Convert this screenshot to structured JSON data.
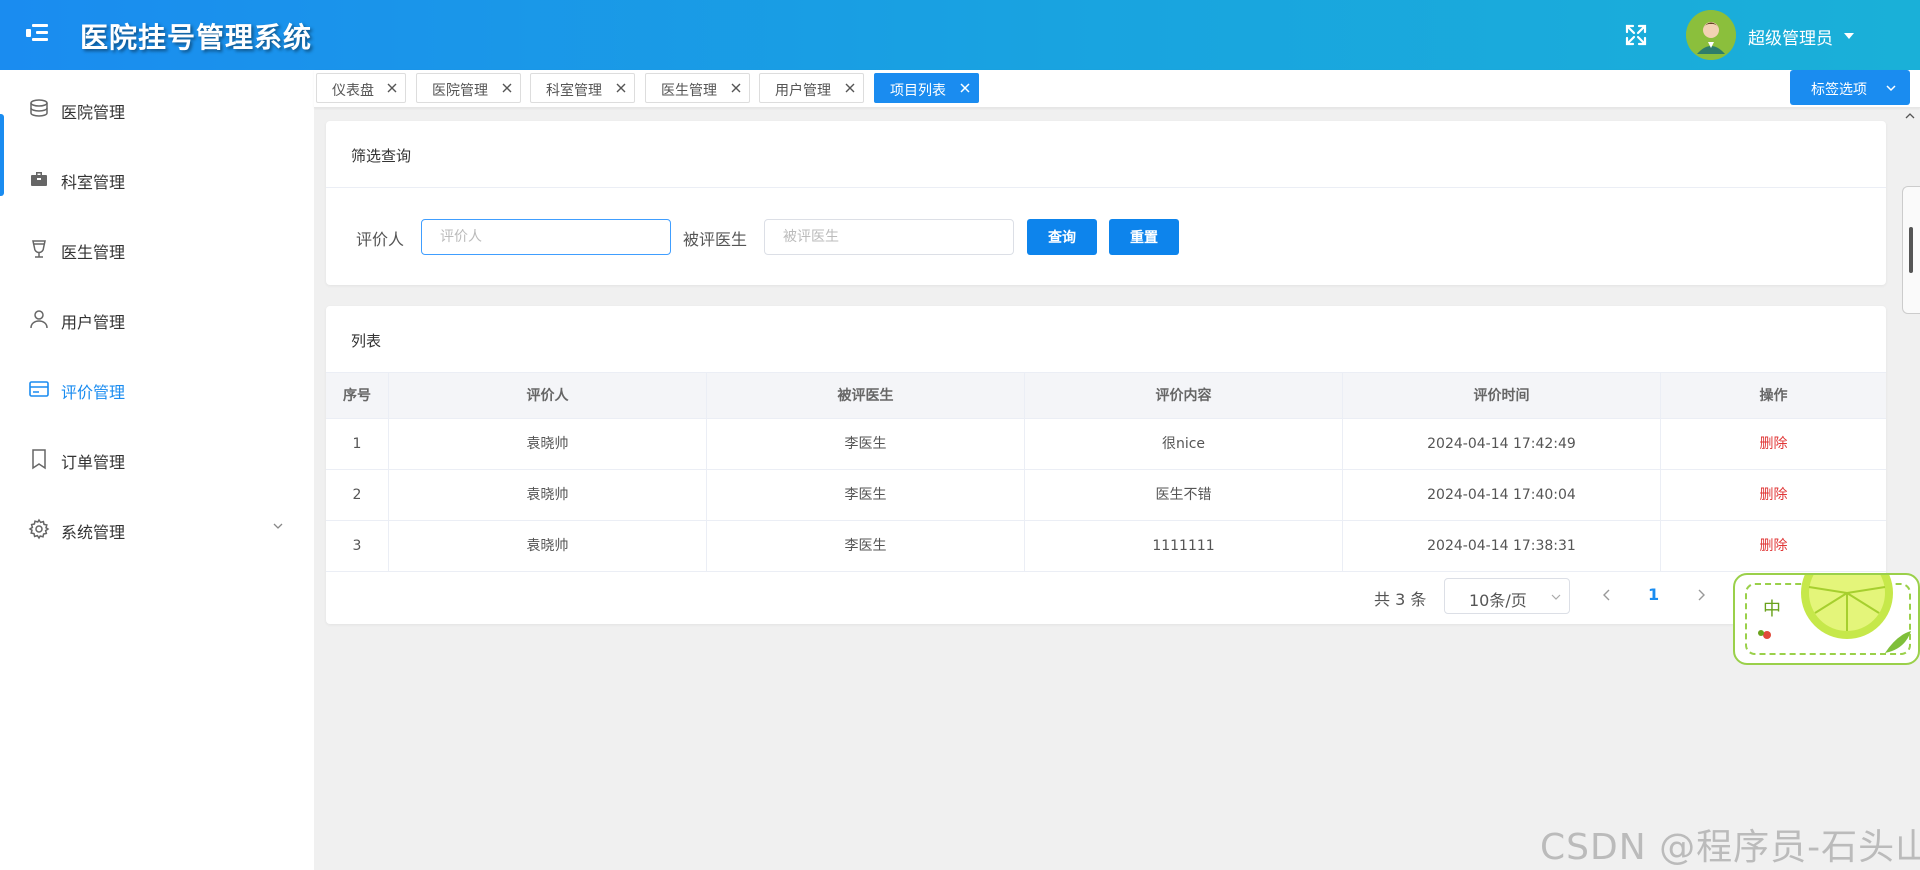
{
  "app": {
    "title": "医院挂号管理系统"
  },
  "header": {
    "user_name": "超级管理员"
  },
  "sidebar": {
    "items": [
      {
        "label": "医院管理",
        "icon": "database-icon"
      },
      {
        "label": "科室管理",
        "icon": "briefcase-icon"
      },
      {
        "label": "医生管理",
        "icon": "goblet-icon"
      },
      {
        "label": "用户管理",
        "icon": "user-icon"
      },
      {
        "label": "评价管理",
        "icon": "card-icon",
        "active": true
      },
      {
        "label": "订单管理",
        "icon": "bookmark-icon"
      },
      {
        "label": "系统管理",
        "icon": "gear-icon",
        "expandable": true
      }
    ]
  },
  "tabs": {
    "items": [
      {
        "label": "仪表盘"
      },
      {
        "label": "医院管理"
      },
      {
        "label": "科室管理"
      },
      {
        "label": "医生管理"
      },
      {
        "label": "用户管理"
      },
      {
        "label": "项目列表",
        "active": true
      }
    ],
    "options_label": "标签选项"
  },
  "filter": {
    "title": "筛选查询",
    "reviewer_label": "评价人",
    "reviewer_placeholder": "评价人",
    "reviewer_value": "",
    "doctor_label": "被评医生",
    "doctor_placeholder": "被评医生",
    "doctor_value": "",
    "search_button": "查询",
    "reset_button": "重置"
  },
  "list": {
    "title": "列表",
    "columns": [
      "序号",
      "评价人",
      "被评医生",
      "评价内容",
      "评价时间",
      "操作"
    ],
    "rows": [
      {
        "index": "1",
        "reviewer": "袁晓帅",
        "doctor": "李医生",
        "content": "很nice",
        "time": "2024-04-14 17:42:49",
        "action": "删除"
      },
      {
        "index": "2",
        "reviewer": "袁晓帅",
        "doctor": "李医生",
        "content": "医生不错",
        "time": "2024-04-14 17:40:04",
        "action": "删除"
      },
      {
        "index": "3",
        "reviewer": "袁晓帅",
        "doctor": "李医生",
        "content": "1111111",
        "time": "2024-04-14 17:38:31",
        "action": "删除"
      }
    ]
  },
  "pagination": {
    "total_label": "共 3 条",
    "page_size": "10条/页",
    "current_page": "1"
  },
  "ime_widget": {
    "char": "中"
  },
  "watermark": "CSDN @程序员-石头山",
  "colors": {
    "primary": "#1a8cf0",
    "danger": "#e03636",
    "header_start": "#1a8cf0",
    "header_end": "#1ab0d8"
  }
}
